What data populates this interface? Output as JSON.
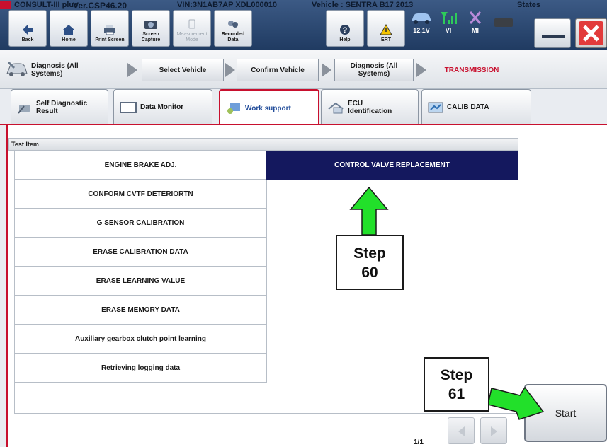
{
  "title_strip": {
    "app": "CONSULT-III plus",
    "version": "Ver.CSP46.20",
    "vin": "VIN:3N1AB7AP XDL000010",
    "vehicle": "Vehicle : SENTRA B17 2013",
    "states": "States"
  },
  "toolbar": {
    "back": "Back",
    "home": "Home",
    "print_screen": "Print Screen",
    "screen_capture": "Screen\nCapture",
    "measurement_mode": "Measurement\nMode",
    "recorded_data": "Recorded\nData",
    "help": "Help",
    "ert": "ERT",
    "battery": "12.1V",
    "vi": "VI",
    "mi": "MI"
  },
  "breadcrumb": {
    "item1": "Diagnosis (All\nSystems)",
    "item2": "Select Vehicle",
    "item3": "Confirm Vehicle",
    "item4": "Diagnosis (All\nSystems)",
    "item5": "TRANSMISSION"
  },
  "tabs": {
    "self_diag": "Self Diagnostic\nResult",
    "data_monitor": "Data Monitor",
    "work_support": "Work support",
    "ecu_id": "ECU\nIdentification",
    "calib": "CALIB DATA"
  },
  "test_item_header": "Test Item",
  "items": [
    "ENGINE BRAKE ADJ.",
    "CONFORM CVTF DETERIORTN",
    "G SENSOR CALIBRATION",
    "ERASE CALIBRATION DATA",
    "ERASE LEARNING VALUE",
    "ERASE MEMORY DATA",
    "Auxiliary gearbox clutch point learning",
    "Retrieving logging data"
  ],
  "selected_item": "CONTROL VALVE REPLACEMENT",
  "pager": "1/1",
  "start_label": "Start",
  "annotations": {
    "step60": "Step\n60",
    "step61": "Step\n61"
  },
  "colors": {
    "accent_red": "#c8102e",
    "selected_navy": "#14185e",
    "arrow_green": "#22e02a"
  }
}
